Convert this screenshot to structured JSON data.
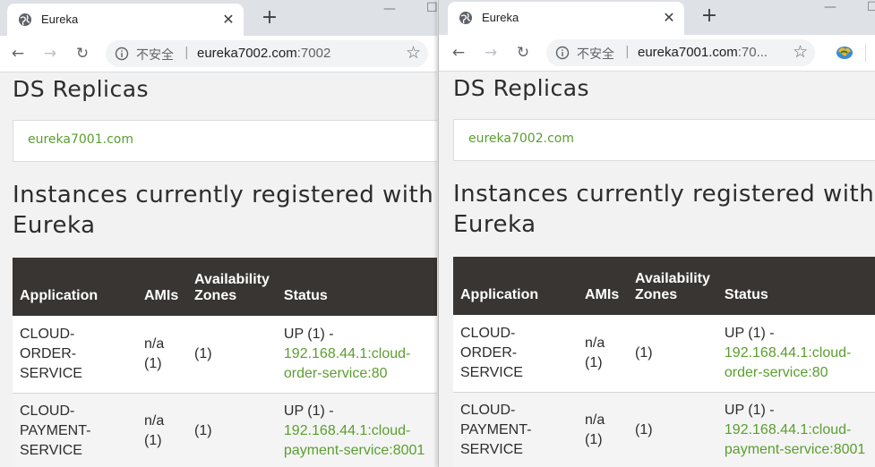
{
  "windows": [
    {
      "tab": {
        "title": "Eureka"
      },
      "url": {
        "security_label": "不安全",
        "host": "eureka7002.com",
        "port": ":7002"
      },
      "page": {
        "replicas_heading": "DS Replicas",
        "replica_link": "eureka7001.com",
        "instances_heading_line1": "Instances currently registered with",
        "instances_heading_line2": "Eureka",
        "columns": [
          "Application",
          "AMIs",
          "Availability",
          "Zones",
          "Status"
        ],
        "rows": [
          {
            "app": [
              "CLOUD-",
              "ORDER-",
              "SERVICE"
            ],
            "amis": [
              "n/a",
              "(1)"
            ],
            "zones": "(1)",
            "status_prefix": "UP (1) -",
            "status_link": [
              "192.168.44.1:cloud-",
              "order-service:80"
            ]
          },
          {
            "app": [
              "CLOUD-",
              "PAYMENT-",
              "SERVICE"
            ],
            "amis": [
              "n/a",
              "(1)"
            ],
            "zones": "(1)",
            "status_prefix": "UP (1) -",
            "status_link": [
              "192.168.44.1:cloud-",
              "payment-service:8001"
            ]
          }
        ]
      }
    },
    {
      "tab": {
        "title": "Eureka"
      },
      "url": {
        "security_label": "不安全",
        "host": "eureka7001.com",
        "port": ":70..."
      },
      "page": {
        "replicas_heading": "DS Replicas",
        "replica_link": "eureka7002.com",
        "instances_heading_line1": "Instances currently registered with",
        "instances_heading_line2": "Eureka",
        "columns": [
          "Application",
          "AMIs",
          "Availability",
          "Zones",
          "Status"
        ],
        "rows": [
          {
            "app": [
              "CLOUD-",
              "ORDER-",
              "SERVICE"
            ],
            "amis": [
              "n/a",
              "(1)"
            ],
            "zones": "(1)",
            "status_prefix": "UP (1) -",
            "status_link": [
              "192.168.44.1:cloud-",
              "order-service:80"
            ]
          },
          {
            "app": [
              "CLOUD-",
              "PAYMENT-",
              "SERVICE"
            ],
            "amis": [
              "n/a",
              "(1)"
            ],
            "zones": "(1)",
            "status_prefix": "UP (1) -",
            "status_link": [
              "192.168.44.1:cloud-",
              "payment-service:8001"
            ]
          }
        ]
      }
    }
  ],
  "icons": {
    "favicon": "globe-icon",
    "info": "info-icon",
    "star": "bookmark-star-icon",
    "extension": "extension-icon"
  },
  "colors": {
    "link_green": "#5a9e2f",
    "table_header": "#383532",
    "tabstrip": "#dee1e6"
  }
}
